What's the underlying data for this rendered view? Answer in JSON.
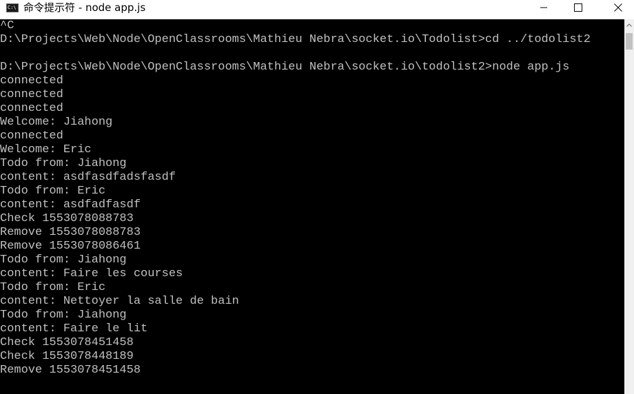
{
  "window": {
    "title": "命令提示符 - node  app.js",
    "icon_text": "C:\\",
    "minimize_icon": "minimize-icon",
    "maximize_icon": "maximize-icon",
    "close_icon": "close-icon"
  },
  "console": {
    "lines": [
      "^C",
      "D:\\Projects\\Web\\Node\\OpenClassrooms\\Mathieu Nebra\\socket.io\\Todolist>cd ../todolist2",
      "",
      "D:\\Projects\\Web\\Node\\OpenClassrooms\\Mathieu Nebra\\socket.io\\todolist2>node app.js",
      "connected",
      "connected",
      "connected",
      "Welcome: Jiahong",
      "connected",
      "Welcome: Eric",
      "Todo from: Jiahong",
      "content: asdfasdfadsfasdf",
      "Todo from: Eric",
      "content: asdfadfasdf",
      "Check 1553078088783",
      "Remove 1553078088783",
      "Remove 1553078086461",
      "Todo from: Jiahong",
      "content: Faire les courses",
      "Todo from: Eric",
      "content: Nettoyer la salle de bain",
      "Todo from: Jiahong",
      "content: Faire le lit",
      "Check 1553078451458",
      "Check 1553078448189",
      "Remove 1553078451458"
    ]
  },
  "colors": {
    "console_background": "#000000",
    "console_text": "#c0c0c0",
    "titlebar_background": "#ffffff"
  }
}
